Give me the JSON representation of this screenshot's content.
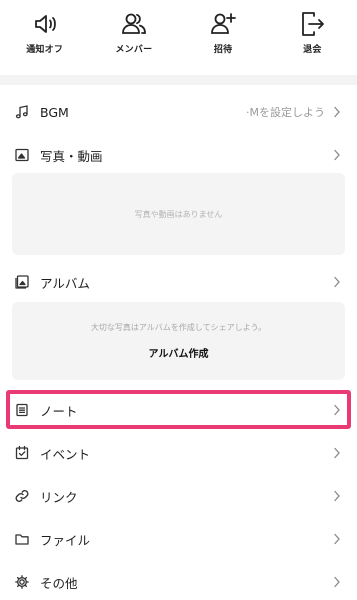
{
  "toolbar": {
    "items": [
      {
        "label": "通知オフ",
        "icon": "speaker-icon"
      },
      {
        "label": "メンバー",
        "icon": "members-icon"
      },
      {
        "label": "招待",
        "icon": "add-user-icon"
      },
      {
        "label": "退会",
        "icon": "leave-icon"
      }
    ]
  },
  "menu": {
    "bgm": {
      "label": "BGM",
      "value": "·Mを設定しよう"
    },
    "photos": {
      "label": "写真・動画",
      "empty_text": "写真や動画はありません"
    },
    "album": {
      "label": "アルバム",
      "hint_text": "大切な写真はアルバムを作成してシェアしよう。",
      "create_label": "アルバム作成"
    },
    "note": {
      "label": "ノート"
    },
    "event": {
      "label": "イベント"
    },
    "link": {
      "label": "リンク"
    },
    "file": {
      "label": "ファイル"
    },
    "other": {
      "label": "その他"
    }
  },
  "colors": {
    "highlight": "#ea3a73",
    "separator": "#f3f3f4",
    "card": "#f4f4f5"
  }
}
